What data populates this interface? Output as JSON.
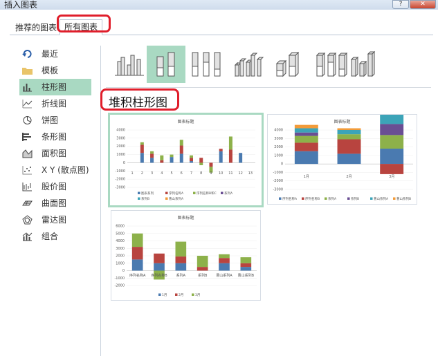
{
  "window": {
    "title": "插入图表",
    "help": "?",
    "close": "✕"
  },
  "tabs": [
    {
      "label": "推荐的图表"
    },
    {
      "label": "所有图表"
    }
  ],
  "sidebar": {
    "items": [
      {
        "label": "最近",
        "icon": "recent-icon"
      },
      {
        "label": "模板",
        "icon": "folder-icon"
      },
      {
        "label": "柱形图",
        "icon": "column-chart-icon"
      },
      {
        "label": "折线图",
        "icon": "line-chart-icon"
      },
      {
        "label": "饼图",
        "icon": "pie-chart-icon"
      },
      {
        "label": "条形图",
        "icon": "bar-chart-icon"
      },
      {
        "label": "面积图",
        "icon": "area-chart-icon"
      },
      {
        "label": "X Y (散点图)",
        "icon": "scatter-chart-icon"
      },
      {
        "label": "股价图",
        "icon": "stock-chart-icon"
      },
      {
        "label": "曲面图",
        "icon": "surface-chart-icon"
      },
      {
        "label": "雷达图",
        "icon": "radar-chart-icon"
      },
      {
        "label": "组合",
        "icon": "combo-chart-icon"
      }
    ],
    "selected": "柱形图"
  },
  "subtypes": {
    "names": [
      "clustered-column",
      "stacked-column",
      "100-stacked-column",
      "3d-clustered-column",
      "3d-stacked-column",
      "3d-100-stacked-column",
      "3d-column"
    ],
    "selected": "stacked-column"
  },
  "section_title": "堆积柱形图",
  "colors": {
    "selection": "#a9d9c2",
    "highlight": "#e01e2b",
    "s1": "#4a7ab0",
    "s2": "#b8443f",
    "s3": "#8db14a",
    "s4": "#6a4e93",
    "s5": "#3ca4b8",
    "s6": "#f29b3a"
  },
  "chart_data": [
    {
      "type": "bar",
      "title": "图表标题",
      "stacked": true,
      "categories": [
        "1",
        "2",
        "3",
        "4",
        "5",
        "6",
        "7",
        "8",
        "9",
        "10",
        "11",
        "12",
        "13"
      ],
      "y_ticks": [
        "4000",
        "3000",
        "2000",
        "1000",
        "0",
        "-1000",
        "-2000",
        "-3000"
      ],
      "ylim": [
        -3000,
        4000
      ],
      "legend": [
        "图表系列",
        "序列名称A",
        "序列名称B和C",
        "系列A",
        "系列B",
        "曹山系列A"
      ],
      "series": [
        {
          "values": [
            0,
            1200,
            600,
            0,
            700,
            1100,
            200,
            0,
            0,
            1400,
            0,
            1200,
            0
          ]
        },
        {
          "values": [
            0,
            1000,
            500,
            300,
            0,
            1000,
            400,
            600,
            -500,
            300,
            1600,
            0,
            0
          ]
        },
        {
          "values": [
            0,
            300,
            300,
            600,
            300,
            700,
            300,
            -300,
            -700,
            0,
            1600,
            0,
            0
          ]
        }
      ]
    },
    {
      "type": "bar",
      "title": "图表标题",
      "stacked": true,
      "categories": [
        "1月",
        "2月",
        "3月"
      ],
      "y_ticks": [
        "4000",
        "3000",
        "2000",
        "1000",
        "0",
        "-1000",
        "-2000",
        "-3000"
      ],
      "ylim": [
        -3000,
        4000
      ],
      "legend": [
        "序列名称A",
        "序列名称B",
        "系列A",
        "系列B",
        "曹山系列A",
        "曹山系列B"
      ],
      "series": [
        {
          "values": [
            1500,
            1200,
            1800
          ]
        },
        {
          "values": [
            1000,
            1700,
            -1200
          ]
        },
        {
          "values": [
            800,
            600,
            1600
          ]
        },
        {
          "values": [
            400,
            0,
            1300
          ]
        },
        {
          "values": [
            500,
            500,
            1200
          ]
        },
        {
          "values": [
            400,
            200,
            700
          ]
        }
      ]
    },
    {
      "type": "bar",
      "title": "图表标题",
      "stacked": true,
      "categories": [
        "序列名称A",
        "序列名称B",
        "系列A",
        "系列B",
        "曹山系列A",
        "曹山系列B"
      ],
      "y_ticks": [
        "6000",
        "5000",
        "4000",
        "3000",
        "2000",
        "1000",
        "0",
        "-1000",
        "-2000"
      ],
      "ylim": [
        -2000,
        6000
      ],
      "legend": [
        "1月",
        "2月",
        "3月"
      ],
      "series": [
        {
          "name": "1月",
          "values": [
            1500,
            1000,
            1000,
            0,
            1000,
            500
          ]
        },
        {
          "name": "2月",
          "values": [
            1700,
            1300,
            900,
            500,
            700,
            500
          ]
        },
        {
          "name": "3月",
          "values": [
            1800,
            -1200,
            2000,
            1500,
            500,
            800
          ]
        }
      ]
    }
  ]
}
